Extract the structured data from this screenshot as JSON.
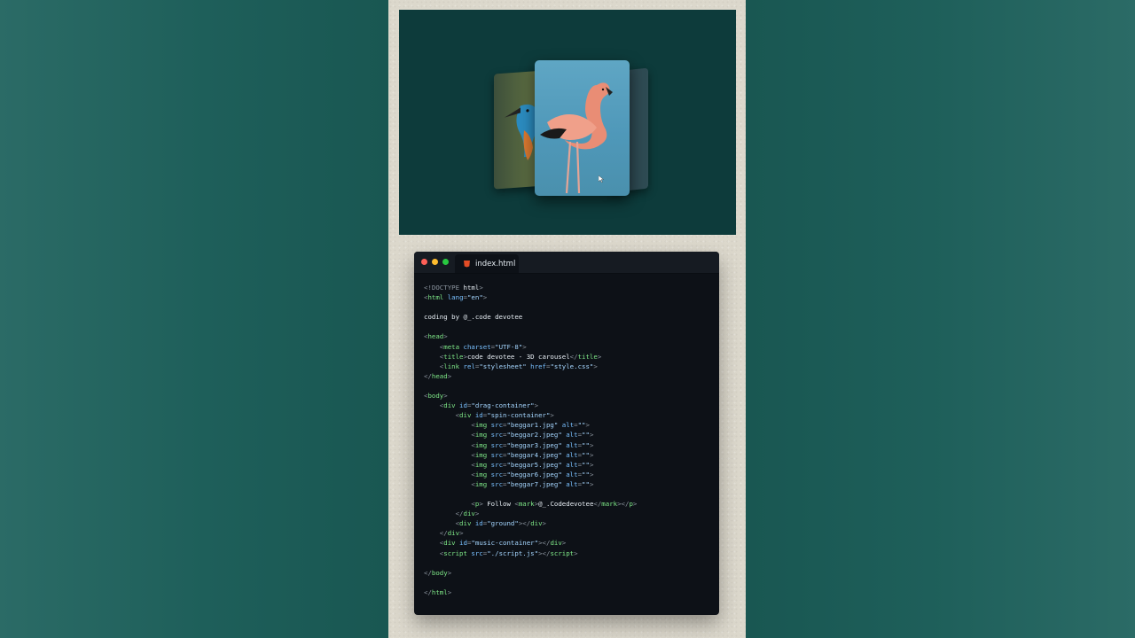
{
  "editor": {
    "tab_label": "index.html",
    "tab_icon": "html5-icon",
    "window_buttons": [
      "close",
      "minimize",
      "maximize"
    ],
    "lines": [
      [
        {
          "t": "<!DOCTYPE ",
          "c": "p"
        },
        {
          "t": "html",
          "c": "x"
        },
        {
          "t": ">",
          "c": "p"
        }
      ],
      [
        {
          "t": "<",
          "c": "p"
        },
        {
          "t": "html",
          "c": "t"
        },
        {
          "t": " lang",
          "c": "a"
        },
        {
          "t": "=",
          "c": "p"
        },
        {
          "t": "\"en\"",
          "c": "s"
        },
        {
          "t": ">",
          "c": "p"
        }
      ],
      [],
      [
        {
          "t": "coding by @_.code devotee",
          "c": "x"
        }
      ],
      [],
      [
        {
          "t": "<",
          "c": "p"
        },
        {
          "t": "head",
          "c": "t"
        },
        {
          "t": ">",
          "c": "p"
        }
      ],
      [
        {
          "t": "    <",
          "c": "p"
        },
        {
          "t": "meta",
          "c": "t"
        },
        {
          "t": " charset",
          "c": "a"
        },
        {
          "t": "=",
          "c": "p"
        },
        {
          "t": "\"UTF-8\"",
          "c": "s"
        },
        {
          "t": ">",
          "c": "p"
        }
      ],
      [
        {
          "t": "    <",
          "c": "p"
        },
        {
          "t": "title",
          "c": "t"
        },
        {
          "t": ">",
          "c": "p"
        },
        {
          "t": "code devotee - 3D carousel",
          "c": "x"
        },
        {
          "t": "</",
          "c": "p"
        },
        {
          "t": "title",
          "c": "t"
        },
        {
          "t": ">",
          "c": "p"
        }
      ],
      [
        {
          "t": "    <",
          "c": "p"
        },
        {
          "t": "link",
          "c": "t"
        },
        {
          "t": " rel",
          "c": "a"
        },
        {
          "t": "=",
          "c": "p"
        },
        {
          "t": "\"stylesheet\"",
          "c": "s"
        },
        {
          "t": " href",
          "c": "a"
        },
        {
          "t": "=",
          "c": "p"
        },
        {
          "t": "\"style.css\"",
          "c": "s"
        },
        {
          "t": ">",
          "c": "p"
        }
      ],
      [
        {
          "t": "</",
          "c": "p"
        },
        {
          "t": "head",
          "c": "t"
        },
        {
          "t": ">",
          "c": "p"
        }
      ],
      [],
      [
        {
          "t": "<",
          "c": "p"
        },
        {
          "t": "body",
          "c": "t"
        },
        {
          "t": ">",
          "c": "p"
        }
      ],
      [
        {
          "t": "    <",
          "c": "p"
        },
        {
          "t": "div",
          "c": "t"
        },
        {
          "t": " id",
          "c": "a"
        },
        {
          "t": "=",
          "c": "p"
        },
        {
          "t": "\"drag-container\"",
          "c": "s"
        },
        {
          "t": ">",
          "c": "p"
        }
      ],
      [
        {
          "t": "        <",
          "c": "p"
        },
        {
          "t": "div",
          "c": "t"
        },
        {
          "t": " id",
          "c": "a"
        },
        {
          "t": "=",
          "c": "p"
        },
        {
          "t": "\"spin-container\"",
          "c": "s"
        },
        {
          "t": ">",
          "c": "p"
        }
      ],
      [
        {
          "t": "            <",
          "c": "p"
        },
        {
          "t": "img",
          "c": "t"
        },
        {
          "t": " src",
          "c": "a"
        },
        {
          "t": "=",
          "c": "p"
        },
        {
          "t": "\"beggar1.jpg\"",
          "c": "s"
        },
        {
          "t": " alt",
          "c": "a"
        },
        {
          "t": "=",
          "c": "p"
        },
        {
          "t": "\"\"",
          "c": "s"
        },
        {
          "t": ">",
          "c": "p"
        }
      ],
      [
        {
          "t": "            <",
          "c": "p"
        },
        {
          "t": "img",
          "c": "t"
        },
        {
          "t": " src",
          "c": "a"
        },
        {
          "t": "=",
          "c": "p"
        },
        {
          "t": "\"beggar2.jpeg\"",
          "c": "s"
        },
        {
          "t": " alt",
          "c": "a"
        },
        {
          "t": "=",
          "c": "p"
        },
        {
          "t": "\"\"",
          "c": "s"
        },
        {
          "t": ">",
          "c": "p"
        }
      ],
      [
        {
          "t": "            <",
          "c": "p"
        },
        {
          "t": "img",
          "c": "t"
        },
        {
          "t": " src",
          "c": "a"
        },
        {
          "t": "=",
          "c": "p"
        },
        {
          "t": "\"beggar3.jpeg\"",
          "c": "s"
        },
        {
          "t": " alt",
          "c": "a"
        },
        {
          "t": "=",
          "c": "p"
        },
        {
          "t": "\"\"",
          "c": "s"
        },
        {
          "t": ">",
          "c": "p"
        }
      ],
      [
        {
          "t": "            <",
          "c": "p"
        },
        {
          "t": "img",
          "c": "t"
        },
        {
          "t": " src",
          "c": "a"
        },
        {
          "t": "=",
          "c": "p"
        },
        {
          "t": "\"beggar4.jpeg\"",
          "c": "s"
        },
        {
          "t": " alt",
          "c": "a"
        },
        {
          "t": "=",
          "c": "p"
        },
        {
          "t": "\"\"",
          "c": "s"
        },
        {
          "t": ">",
          "c": "p"
        }
      ],
      [
        {
          "t": "            <",
          "c": "p"
        },
        {
          "t": "img",
          "c": "t"
        },
        {
          "t": " src",
          "c": "a"
        },
        {
          "t": "=",
          "c": "p"
        },
        {
          "t": "\"beggar5.jpeg\"",
          "c": "s"
        },
        {
          "t": " alt",
          "c": "a"
        },
        {
          "t": "=",
          "c": "p"
        },
        {
          "t": "\"\"",
          "c": "s"
        },
        {
          "t": ">",
          "c": "p"
        }
      ],
      [
        {
          "t": "            <",
          "c": "p"
        },
        {
          "t": "img",
          "c": "t"
        },
        {
          "t": " src",
          "c": "a"
        },
        {
          "t": "=",
          "c": "p"
        },
        {
          "t": "\"beggar6.jpeg\"",
          "c": "s"
        },
        {
          "t": " alt",
          "c": "a"
        },
        {
          "t": "=",
          "c": "p"
        },
        {
          "t": "\"\"",
          "c": "s"
        },
        {
          "t": ">",
          "c": "p"
        }
      ],
      [
        {
          "t": "            <",
          "c": "p"
        },
        {
          "t": "img",
          "c": "t"
        },
        {
          "t": " src",
          "c": "a"
        },
        {
          "t": "=",
          "c": "p"
        },
        {
          "t": "\"beggar7.jpeg\"",
          "c": "s"
        },
        {
          "t": " alt",
          "c": "a"
        },
        {
          "t": "=",
          "c": "p"
        },
        {
          "t": "\"\"",
          "c": "s"
        },
        {
          "t": ">",
          "c": "p"
        }
      ],
      [],
      [
        {
          "t": "            <",
          "c": "p"
        },
        {
          "t": "p",
          "c": "t"
        },
        {
          "t": "> ",
          "c": "p"
        },
        {
          "t": "Follow ",
          "c": "x"
        },
        {
          "t": "<",
          "c": "p"
        },
        {
          "t": "mark",
          "c": "t"
        },
        {
          "t": ">",
          "c": "p"
        },
        {
          "t": "@_.Codedevotee",
          "c": "x"
        },
        {
          "t": "</",
          "c": "p"
        },
        {
          "t": "mark",
          "c": "t"
        },
        {
          "t": "></",
          "c": "p"
        },
        {
          "t": "p",
          "c": "t"
        },
        {
          "t": ">",
          "c": "p"
        }
      ],
      [
        {
          "t": "        </",
          "c": "p"
        },
        {
          "t": "div",
          "c": "t"
        },
        {
          "t": ">",
          "c": "p"
        }
      ],
      [
        {
          "t": "        <",
          "c": "p"
        },
        {
          "t": "div",
          "c": "t"
        },
        {
          "t": " id",
          "c": "a"
        },
        {
          "t": "=",
          "c": "p"
        },
        {
          "t": "\"ground\"",
          "c": "s"
        },
        {
          "t": "></",
          "c": "p"
        },
        {
          "t": "div",
          "c": "t"
        },
        {
          "t": ">",
          "c": "p"
        }
      ],
      [
        {
          "t": "    </",
          "c": "p"
        },
        {
          "t": "div",
          "c": "t"
        },
        {
          "t": ">",
          "c": "p"
        }
      ],
      [
        {
          "t": "    <",
          "c": "p"
        },
        {
          "t": "div",
          "c": "t"
        },
        {
          "t": " id",
          "c": "a"
        },
        {
          "t": "=",
          "c": "p"
        },
        {
          "t": "\"music-container\"",
          "c": "s"
        },
        {
          "t": "></",
          "c": "p"
        },
        {
          "t": "div",
          "c": "t"
        },
        {
          "t": ">",
          "c": "p"
        }
      ],
      [
        {
          "t": "    <",
          "c": "p"
        },
        {
          "t": "script",
          "c": "t"
        },
        {
          "t": " src",
          "c": "a"
        },
        {
          "t": "=",
          "c": "p"
        },
        {
          "t": "\"./script.js\"",
          "c": "s"
        },
        {
          "t": "></",
          "c": "p"
        },
        {
          "t": "script",
          "c": "t"
        },
        {
          "t": ">",
          "c": "p"
        }
      ],
      [],
      [
        {
          "t": "</",
          "c": "p"
        },
        {
          "t": "body",
          "c": "t"
        },
        {
          "t": ">",
          "c": "p"
        }
      ],
      [],
      [
        {
          "t": "</",
          "c": "p"
        },
        {
          "t": "html",
          "c": "t"
        },
        {
          "t": ">",
          "c": "p"
        }
      ]
    ]
  },
  "preview": {
    "cards": [
      "kingfisher-photo",
      "flamingo-photo",
      "dark-photo"
    ],
    "colors": {
      "stage": "#0d3b3b",
      "card_sky": "#5fa6c4"
    }
  }
}
